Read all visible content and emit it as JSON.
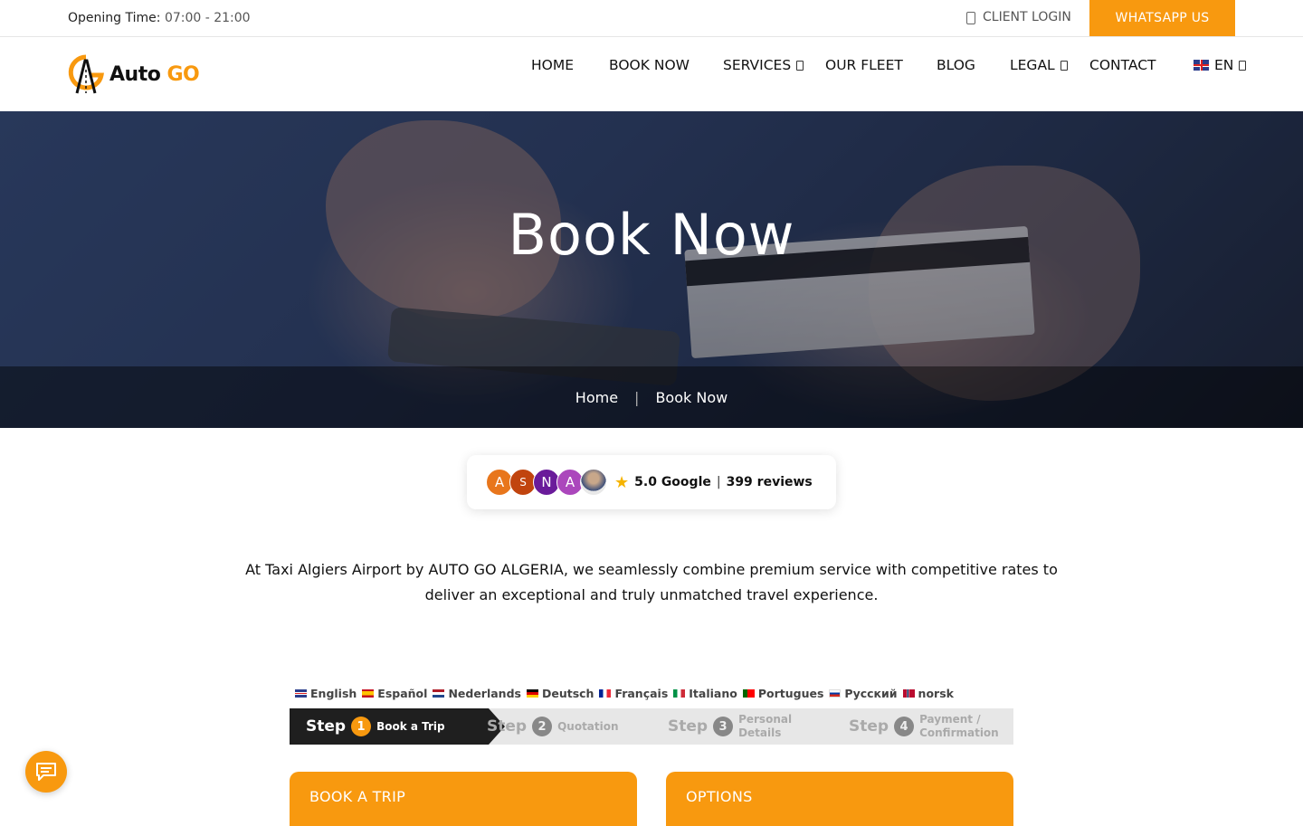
{
  "topbar": {
    "opening_label": "Opening Time:",
    "opening_hours": "07:00 - 21:00",
    "client_login": "CLIENT LOGIN",
    "whatsapp": "WHATSAPP US"
  },
  "logo": {
    "brand_a": "Auto ",
    "brand_b": "GO"
  },
  "nav": {
    "home": "HOME",
    "book_now": "BOOK NOW",
    "services": "SERVICES",
    "our_fleet": "OUR FLEET",
    "blog": "BLOG",
    "legal": "LEGAL",
    "contact": "CONTACT",
    "language": "EN"
  },
  "hero": {
    "title": "Book Now",
    "breadcrumb": [
      "Home",
      "|",
      "Book Now"
    ]
  },
  "reviews": {
    "avatars": [
      "A",
      "S",
      "N",
      "A"
    ],
    "score": "5.0 Google",
    "separator": "|",
    "count": "399 reviews",
    "colors": {
      "a1": "#e8761c",
      "s": "#c1440e",
      "n": "#6a1b9a",
      "a2": "#ab47bc"
    }
  },
  "intro": "At Taxi Algiers Airport by AUTO GO ALGERIA, we seamlessly combine premium service with competitive rates to deliver an exceptional and truly unmatched travel experience.",
  "languages": [
    "English",
    "Español",
    "Nederlands",
    "Deutsch",
    "Français",
    "Italiano",
    "Portugues",
    "Русский",
    "norsk"
  ],
  "steps": [
    {
      "word": "Step",
      "num": "1",
      "label": "Book a Trip"
    },
    {
      "word": "Step",
      "num": "2",
      "label": "Quotation"
    },
    {
      "word": "Step",
      "num": "3",
      "label": "Personal Details"
    },
    {
      "word": "Step",
      "num": "4",
      "label": "Payment / Confirmation"
    }
  ],
  "panels": {
    "left": "BOOK A TRIP",
    "right": "OPTIONS"
  },
  "accent_color": "#f8990f"
}
